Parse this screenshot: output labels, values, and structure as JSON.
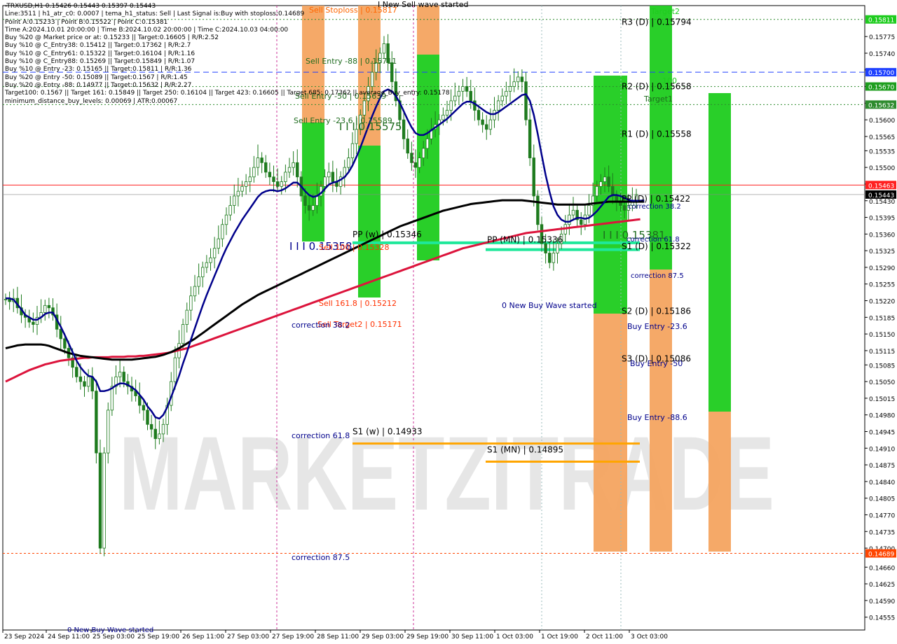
{
  "info_lines": [
    "-TRXUSD,H1  0.15426 0.15443 0.15397 0.15443",
    "Line:3511 | h1_atr_c0: 0.0007 | tema_h1_status: Sell | Last Signal is:Buy with stoploss:0.14689",
    "Point A:0.15233 | Point B:0.15522 | Point C:0.15381",
    "Time A:2024.10.01 20:00:00 | Time B:2024.10.02 20:00:00 | Time C:2024.10.03 04:00:00",
    "Buy %20 @ Market price or at: 0.15233 || Target:0.16605 | R/R:2.52",
    "Buy %10 @ C_Entry38: 0.15412 || Target:0.17362 | R/R:2.7",
    "Buy %10 @ C_Entry61: 0.15322 || Target:0.16104 | R/R:1.16",
    "Buy %10 @ C_Entry88: 0.15269 || Target:0.15849 | R/R:1.07",
    "Buy %10 @ Entry -23: 0.15165 || Target:0.15811 | R/R:1.36",
    "Buy %20 @ Entry -50: 0.15089 || Target:0.1567 | R/R:1.45",
    "Buy %20 @ Entry -88: 0.14977 || Target:0.15632 | R/R:2.27",
    "Target100: 0.1567 || Target 161: 0.15849 || Target 250: 0.16104 || Target 423: 0.16605 || Target 685: 0.17362 || average_Buy_entry: 0.15178",
    "minimum_distance_buy_levels: 0.00069 | ATR:0.00067"
  ],
  "watermark": "MARKETZITRADE",
  "colors": {
    "bull": "#1e7b1e",
    "bear": "#1e7b1e",
    "ema_blue": "#00008b",
    "ema_black": "#000000",
    "ema_red": "#dc143c",
    "green_zone": "#1ecc1e",
    "orange_zone": "#f4a460",
    "pivot_green": "#1ee89a",
    "pivot_orange": "#ffa500"
  },
  "chart_data": {
    "type": "candlestick",
    "symbol": "TRXUSD",
    "timeframe": "H1",
    "ylim": [
      0.14528,
      0.1584
    ],
    "y_ticks": [
      "0.15775",
      "0.15740",
      "0.15705",
      "0.15670",
      "0.15635",
      "0.15600",
      "0.15565",
      "0.15535",
      "0.15500",
      "0.15465",
      "0.15430",
      "0.15395",
      "0.15360",
      "0.15325",
      "0.15290",
      "0.15255",
      "0.15220",
      "0.15185",
      "0.15150",
      "0.15115",
      "0.15085",
      "0.15050",
      "0.15015",
      "0.14980",
      "0.14945",
      "0.14910",
      "0.14875",
      "0.14840",
      "0.14805",
      "0.14770",
      "0.14735",
      "0.14700",
      "0.14660",
      "0.14625",
      "0.14590",
      "0.14555"
    ],
    "x_ticks": [
      "23 Sep 2024",
      "24 Sep 11:00",
      "25 Sep 03:00",
      "25 Sep 19:00",
      "26 Sep 11:00",
      "27 Sep 03:00",
      "27 Sep 19:00",
      "28 Sep 11:00",
      "29 Sep 03:00",
      "29 Sep 19:00",
      "30 Sep 11:00",
      "1 Oct 03:00",
      "1 Oct 19:00",
      "2 Oct 11:00",
      "3 Oct 03:00"
    ],
    "price_badges": [
      {
        "value": "0.15811",
        "bg": "#1ecc1e",
        "fg": "#ffffff"
      },
      {
        "value": "0.15700",
        "bg": "#1e40ff",
        "fg": "#ffffff"
      },
      {
        "value": "0.15670",
        "bg": "#1e9e1e",
        "fg": "#ffffff"
      },
      {
        "value": "0.15632",
        "bg": "#2e8b2e",
        "fg": "#ffffff"
      },
      {
        "value": "0.15463",
        "bg": "#ff2020",
        "fg": "#ffffff"
      },
      {
        "value": "0.15443",
        "bg": "#000000",
        "fg": "#ffffff"
      },
      {
        "value": "0.14689",
        "bg": "#ff4500",
        "fg": "#ffffff"
      }
    ],
    "closes": [
      0.15223,
      0.15218,
      0.15225,
      0.15205,
      0.1519,
      0.15185,
      0.15175,
      0.1517,
      0.15185,
      0.15195,
      0.1521,
      0.15205,
      0.1519,
      0.1516,
      0.1514,
      0.1512,
      0.151,
      0.1508,
      0.1506,
      0.1505,
      0.1504,
      0.1506,
      0.1503,
      0.149,
      0.147,
      0.149,
      0.1499,
      0.1504,
      0.1506,
      0.1507,
      0.1505,
      0.1504,
      0.1503,
      0.1502,
      0.15,
      0.1499,
      0.1496,
      0.1495,
      0.1493,
      0.1494,
      0.1496,
      0.15,
      0.1505,
      0.151,
      0.1513,
      0.1517,
      0.152,
      0.1523,
      0.1525,
      0.1527,
      0.1529,
      0.153,
      0.1531,
      0.1533,
      0.1535,
      0.1538,
      0.154,
      0.1542,
      0.1544,
      0.1545,
      0.1546,
      0.1547,
      0.1548,
      0.155,
      0.1552,
      0.1551,
      0.1549,
      0.1548,
      0.1547,
      0.1546,
      0.1547,
      0.1549,
      0.155,
      0.1551,
      0.1548,
      0.1544,
      0.1542,
      0.1541,
      0.1542,
      0.1544,
      0.1546,
      0.1548,
      0.1549,
      0.1547,
      0.1546,
      0.1548,
      0.155,
      0.1552,
      0.1555,
      0.1558,
      0.1561,
      0.1564,
      0.1567,
      0.157,
      0.1572,
      0.1574,
      0.1576,
      0.1572,
      0.1568,
      0.1564,
      0.156,
      0.1556,
      0.1553,
      0.1551,
      0.155,
      0.1552,
      0.1554,
      0.1556,
      0.1558,
      0.1559,
      0.156,
      0.1561,
      0.1562,
      0.1564,
      0.1565,
      0.1566,
      0.1567,
      0.1566,
      0.1564,
      0.1562,
      0.156,
      0.1559,
      0.1558,
      0.156,
      0.1562,
      0.1564,
      0.1565,
      0.1566,
      0.1567,
      0.1568,
      0.1569,
      0.1568,
      0.156,
      0.1552,
      0.1544,
      0.1538,
      0.1534,
      0.1532,
      0.153,
      0.1532,
      0.1534,
      0.1536,
      0.1538,
      0.154,
      0.1541,
      0.1539,
      0.1538,
      0.154,
      0.1542,
      0.1544,
      0.1546,
      0.1547,
      0.1548,
      0.1546,
      0.1544,
      0.1543,
      0.1542,
      0.1541,
      0.1542,
      0.1543,
      0.15443
    ],
    "ema_blue": [
      0.15225,
      0.15225,
      0.15222,
      0.15212,
      0.15202,
      0.1519,
      0.15185,
      0.1518,
      0.1518,
      0.15185,
      0.15192,
      0.15195,
      0.15195,
      0.1518,
      0.15165,
      0.15148,
      0.1513,
      0.15112,
      0.15094,
      0.1508,
      0.1507,
      0.15062,
      0.1506,
      0.1505,
      0.1503,
      0.1503,
      0.15032,
      0.15036,
      0.15042,
      0.15046,
      0.15046,
      0.15043,
      0.15038,
      0.15032,
      0.15022,
      0.15012,
      0.14998,
      0.14988,
      0.14975,
      0.14972,
      0.1498,
      0.14996,
      0.15018,
      0.1504,
      0.15062,
      0.15088,
      0.15112,
      0.15138,
      0.15162,
      0.15186,
      0.1521,
      0.15232,
      0.15252,
      0.15272,
      0.15292,
      0.15312,
      0.1533,
      0.15346,
      0.15362,
      0.15376,
      0.1539,
      0.15402,
      0.15414,
      0.15426,
      0.15438,
      0.15446,
      0.1545,
      0.15452,
      0.15452,
      0.1545,
      0.15452,
      0.15456,
      0.15462,
      0.15468,
      0.15468,
      0.1546,
      0.1545,
      0.15442,
      0.15438,
      0.1544,
      0.15446,
      0.15455,
      0.15464,
      0.15468,
      0.1547,
      0.15474,
      0.1548,
      0.1549,
      0.15504,
      0.15522,
      0.15542,
      0.15564,
      0.15586,
      0.15608,
      0.15628,
      0.15646,
      0.1566,
      0.15664,
      0.1566,
      0.1565,
      0.15636,
      0.15618,
      0.156,
      0.15584,
      0.15572,
      0.15568,
      0.15568,
      0.15572,
      0.15578,
      0.15584,
      0.1559,
      0.15596,
      0.15602,
      0.1561,
      0.15618,
      0.15626,
      0.15634,
      0.15638,
      0.15638,
      0.15634,
      0.15628,
      0.15622,
      0.15616,
      0.15612,
      0.15612,
      0.15616,
      0.15622,
      0.15628,
      0.15634,
      0.1564,
      0.15646,
      0.15652,
      0.15654,
      0.1564,
      0.1561,
      0.1557,
      0.15526,
      0.15484,
      0.15448,
      0.15418,
      0.154,
      0.1539,
      0.15386,
      0.15386,
      0.1539,
      0.15394,
      0.15394,
      0.15392,
      0.15394,
      0.154,
      0.15408,
      0.15418,
      0.15428,
      0.15438,
      0.15442,
      0.15442,
      0.1544,
      0.15436,
      0.15432,
      0.1543,
      0.1543,
      0.1543,
      0.15431
    ],
    "ema_black": [
      0.1512,
      0.15122,
      0.15124,
      0.15126,
      0.15127,
      0.15128,
      0.15128,
      0.15128,
      0.15128,
      0.15128,
      0.15127,
      0.15125,
      0.15122,
      0.15119,
      0.15116,
      0.15113,
      0.1511,
      0.15108,
      0.15106,
      0.15104,
      0.15103,
      0.15102,
      0.15101,
      0.151,
      0.15099,
      0.15098,
      0.15097,
      0.15096,
      0.15096,
      0.15096,
      0.15096,
      0.15096,
      0.15096,
      0.15097,
      0.15098,
      0.15099,
      0.151,
      0.15101,
      0.15102,
      0.15104,
      0.15106,
      0.15109,
      0.15112,
      0.15116,
      0.1512,
      0.15125,
      0.1513,
      0.15135,
      0.1514,
      0.15146,
      0.15152,
      0.15158,
      0.15164,
      0.1517,
      0.15176,
      0.15182,
      0.15188,
      0.15194,
      0.152,
      0.15206,
      0.15212,
      0.15217,
      0.15222,
      0.15227,
      0.15232,
      0.15236,
      0.1524,
      0.15244,
      0.15248,
      0.15252,
      0.15256,
      0.1526,
      0.15264,
      0.15268,
      0.15272,
      0.15276,
      0.1528,
      0.15284,
      0.15288,
      0.15292,
      0.15296,
      0.153,
      0.15304,
      0.15308,
      0.15312,
      0.15316,
      0.1532,
      0.15324,
      0.15328,
      0.15332,
      0.15336,
      0.1534,
      0.15344,
      0.15348,
      0.15352,
      0.15356,
      0.1536,
      0.15364,
      0.15368,
      0.15372,
      0.15376,
      0.15379,
      0.15382,
      0.15385,
      0.15388,
      0.15391,
      0.15394,
      0.15397,
      0.154,
      0.15403,
      0.15406,
      0.15409,
      0.15411,
      0.15413,
      0.15415,
      0.15417,
      0.15419,
      0.15421,
      0.15423,
      0.15424,
      0.15425,
      0.15426,
      0.15427,
      0.15428,
      0.15429,
      0.1543,
      0.15431,
      0.15431,
      0.15431,
      0.15431,
      0.15431,
      0.15431,
      0.1543,
      0.15429,
      0.15428,
      0.15427,
      0.15426,
      0.15425,
      0.15424,
      0.15423,
      0.15422,
      0.15422,
      0.15422,
      0.15422,
      0.15422,
      0.15422,
      0.15422,
      0.15422,
      0.15423,
      0.15424,
      0.15425,
      0.15426,
      0.15427,
      0.15428,
      0.15428,
      0.15428,
      0.15428,
      0.15428,
      0.15428,
      0.15428,
      0.15428,
      0.15428,
      0.15428
    ],
    "ema_red": [
      0.1505,
      0.15054,
      0.15058,
      0.15062,
      0.15066,
      0.1507,
      0.15074,
      0.15077,
      0.1508,
      0.15083,
      0.15086,
      0.15088,
      0.1509,
      0.15092,
      0.15094,
      0.15095,
      0.15096,
      0.15097,
      0.15098,
      0.15099,
      0.151,
      0.151,
      0.15101,
      0.15101,
      0.15101,
      0.15101,
      0.15101,
      0.15102,
      0.15102,
      0.15102,
      0.15102,
      0.15103,
      0.15103,
      0.15103,
      0.15104,
      0.15104,
      0.15105,
      0.15106,
      0.15107,
      0.15108,
      0.15109,
      0.1511,
      0.15112,
      0.15114,
      0.15116,
      0.15118,
      0.1512,
      0.15123,
      0.15126,
      0.15129,
      0.15132,
      0.15135,
      0.15138,
      0.15141,
      0.15144,
      0.15147,
      0.1515,
      0.15153,
      0.15156,
      0.15159,
      0.15162,
      0.15165,
      0.15168,
      0.15171,
      0.15174,
      0.15177,
      0.1518,
      0.15183,
      0.15186,
      0.15189,
      0.15192,
      0.15195,
      0.15198,
      0.15201,
      0.15204,
      0.15207,
      0.1521,
      0.15213,
      0.15216,
      0.15219,
      0.15222,
      0.15225,
      0.15228,
      0.15231,
      0.15234,
      0.15237,
      0.1524,
      0.15243,
      0.15246,
      0.15249,
      0.15252,
      0.15255,
      0.15258,
      0.15261,
      0.15264,
      0.15267,
      0.1527,
      0.15273,
      0.15276,
      0.15279,
      0.15282,
      0.15285,
      0.15288,
      0.15291,
      0.15294,
      0.15297,
      0.153,
      0.15303,
      0.15306,
      0.15309,
      0.15312,
      0.15315,
      0.15318,
      0.15321,
      0.15324,
      0.15327,
      0.1533,
      0.15332,
      0.15334,
      0.15336,
      0.15338,
      0.1534,
      0.15342,
      0.15344,
      0.15346,
      0.15348,
      0.1535,
      0.15352,
      0.15354,
      0.15356,
      0.15358,
      0.1536,
      0.15362,
      0.15363,
      0.15364,
      0.15365,
      0.15366,
      0.15367,
      0.15368,
      0.15369,
      0.1537,
      0.15371,
      0.15372,
      0.15373,
      0.15374,
      0.15375,
      0.15376,
      0.15377,
      0.15378,
      0.15379,
      0.1538,
      0.15381,
      0.15382,
      0.15383,
      0.15384,
      0.15385,
      0.15386,
      0.15387,
      0.15388,
      0.15389,
      0.1539,
      0.15391
    ],
    "zones": [
      {
        "x0": 431,
        "x1": 463,
        "top": 0.15811,
        "bottom": 0.15811,
        "color": "#f4a460",
        "h": [
          8,
          175
        ]
      },
      {
        "x0": 431,
        "x1": 463,
        "color": "#1ecc1e",
        "h": [
          175,
          345
        ]
      },
      {
        "x0": 511,
        "x1": 543,
        "color": "#f4a460",
        "h": [
          8,
          208
        ]
      },
      {
        "x0": 511,
        "x1": 543,
        "color": "#1ecc1e",
        "h": [
          208,
          425
        ]
      },
      {
        "x0": 595,
        "x1": 627,
        "color": "#f4a460",
        "h": [
          8,
          78
        ]
      },
      {
        "x0": 595,
        "x1": 627,
        "color": "#1ecc1e",
        "h": [
          78,
          372
        ]
      },
      {
        "x0": 847,
        "x1": 895,
        "color": "#1ecc1e",
        "h": [
          108,
          448
        ]
      },
      {
        "x0": 847,
        "x1": 895,
        "color": "#f4a460",
        "h": [
          448,
          788
        ]
      },
      {
        "x0": 927,
        "x1": 959,
        "color": "#1ecc1e",
        "h": [
          8,
          385
        ]
      },
      {
        "x0": 927,
        "x1": 959,
        "color": "#f4a460",
        "h": [
          385,
          788
        ]
      },
      {
        "x0": 1011,
        "x1": 1043,
        "color": "#1ecc1e",
        "h": [
          133,
          588
        ]
      },
      {
        "x0": 1011,
        "x1": 1043,
        "color": "#f4a460",
        "h": [
          588,
          788
        ]
      }
    ],
    "levels": [
      {
        "label": "R3 (D) | 0.15794",
        "y": 0.15794
      },
      {
        "label": "R2 (D) | 0.15658",
        "y": 0.15658
      },
      {
        "label": "R1 (D) | 0.15558",
        "y": 0.15558
      },
      {
        "label": "PP (D) | 0.15422",
        "y": 0.15422
      },
      {
        "label": "S1 (D) | 0.15322",
        "y": 0.15322
      },
      {
        "label": "S2 (D) | 0.15186",
        "y": 0.15186
      },
      {
        "label": "S3 (D) | 0.15086",
        "y": 0.15086
      },
      {
        "label": "PP (w) | 0.15346",
        "y": 0.15346
      },
      {
        "label": "PP (MN) | 0.15336",
        "y": 0.15336
      },
      {
        "label": "S1 (w) | 0.14933",
        "y": 0.14933
      },
      {
        "label": "S1 (MN) | 0.14895",
        "y": 0.14895
      }
    ],
    "annotations": [
      "Sell Stoploss | 0.15817",
      "Sell Entry -88 | 0.15711",
      "Sell Entry -50 | 0.15639",
      "Sell Entry -23.6 | 0.15589",
      "I I I 0.15575",
      "I I I 0.15358",
      "Sell 100 | 0.15328",
      "Sell 161.8 | 0.15212",
      "Sell Target2 | 0.15171",
      "correction 38.2",
      "correction 61.8",
      "correction 87.5",
      "I New Sell wave started",
      "0 New Buy Wave started",
      "Buy Entry -23.6",
      "Buy Entry -50",
      "Buy Entry -88.6",
      "Target2",
      "Target1",
      "100",
      "I I I 0.15381"
    ]
  }
}
